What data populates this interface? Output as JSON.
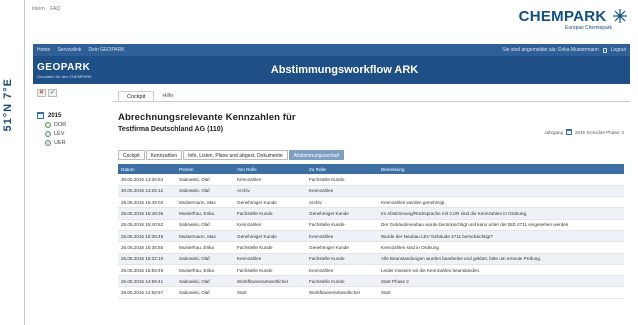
{
  "top_links": [
    "Intern",
    "FAQ"
  ],
  "logo": {
    "word": "CHEMPARK",
    "sub": "Europas Chemiepark"
  },
  "vertical_label": "51°N 7°E",
  "nav": {
    "items": [
      "Home",
      "Servicelink",
      "Dein GEOPARK"
    ],
    "logged_in_text": "Sie sind angemeldet als: Erika Mustermann",
    "logout_label": "Logout"
  },
  "brand": {
    "title": "GEOPARK",
    "subtitle": "Geodaten für den CHEMPARK"
  },
  "banner_title": "Abstimmungsworkflow ARK",
  "toolbar": {
    "reject": "✕",
    "approve": "✓"
  },
  "main_tabs": [
    {
      "label": "Cockpit",
      "active": true
    },
    {
      "label": "Hilfe",
      "active": false
    }
  ],
  "sidebar": {
    "year": "2015",
    "sites": [
      "DOR",
      "LEV",
      "UER"
    ]
  },
  "heading": "Abrechnungsrelevante Kennzahlen für",
  "company": "Testfirma Deutschland AG (110)",
  "year_selector": {
    "label": "Jahrgang",
    "year": "2015",
    "phase": "Erreichte Phase: 2"
  },
  "sub_tabs": [
    {
      "label": "Cockpit",
      "active": false
    },
    {
      "label": "Kennzahlen",
      "active": false
    },
    {
      "label": "Info, Listen, Pläne und abgest. Dokumente",
      "active": false
    },
    {
      "label": "Abstimmungsverlauf",
      "active": true
    }
  ],
  "table": {
    "headers": [
      "Datum",
      "Person",
      "Von Rolle",
      "Zu Rolle",
      "Bemerkung"
    ],
    "rows": [
      [
        "30.05.2016 13:26:54",
        "Sabowski, Olaf",
        "Kennzahlen",
        "Fachstelle Kunde",
        ""
      ],
      [
        "30.05.2016 13:26:12",
        "Sabowski, Olaf",
        "Archiv",
        "Kennzahlen",
        ""
      ],
      [
        "25.05.2016 15:49:02",
        "Mustermann, Max",
        "Genehmiger Kunde",
        "Archiv",
        "Kennzahlen werden genehmigt."
      ],
      [
        "25.05.2016 15:48:36",
        "Musterfrau, Erika",
        "Fachstelle Kunde",
        "Genehmiger Kunde",
        "Im Abstimmung/Rücksprache mit CUR sind die Kennzahlen in Ordnung."
      ],
      [
        "25.05.2016 15:40:52",
        "Sabowski, Olaf",
        "Kennzahlen",
        "Fachstelle Kunde",
        "Der Gebäudeneubau wurde berücksichtigt und kann unter der BID 4711 eingesehen werden."
      ],
      [
        "25.05.2016 15:35:49",
        "Mustermann, Max",
        "Genehmiger Kunde",
        "Kennzahlen",
        "Wurde der Neubau LEV Gebäude 4711 berücksichtigt?"
      ],
      [
        "25.05.2016 15:35:55",
        "Musterfrau, Erika",
        "Fachstelle Kunde",
        "Genehmiger Kunde",
        "Kennzahlen sind in Ordnung"
      ],
      [
        "25.05.2016 15:32:10",
        "Sabowski, Olaf",
        "Kennzahlen",
        "Fachstelle Kunde",
        "Alle Beanstandungen wurden bearbeitet und geklärt, bitte um erneute Prüfung."
      ],
      [
        "25.05.2016 15:59:49",
        "Musterfrau, Erika",
        "Fachstelle Kunde",
        "Kennzahlen",
        "Leider müssen wir die Kennzahlen beanstanden."
      ],
      [
        "25.05.2016 14:59:41",
        "Sabowski, Olaf",
        "Workflowverantwortlicher",
        "Fachstelle Kunde",
        "Start Phase 2"
      ],
      [
        "25.05.2016 14:58:57",
        "Sabowski, Olaf",
        "Start",
        "Workflowverantwortlicher",
        "Start"
      ]
    ]
  }
}
